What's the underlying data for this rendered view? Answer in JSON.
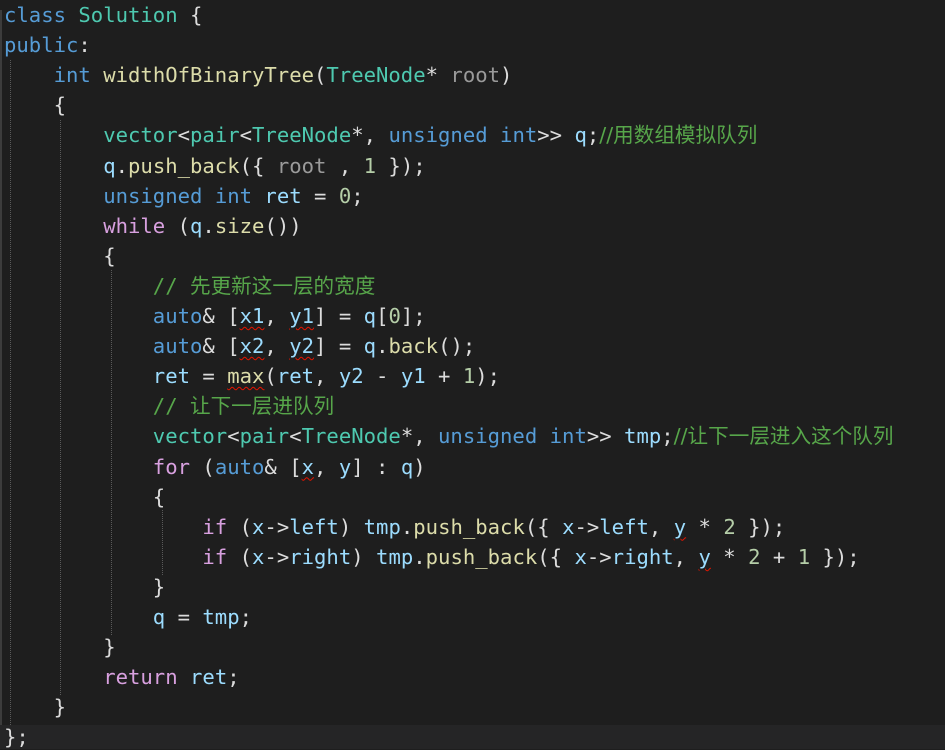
{
  "editor": {
    "lines": [
      [
        [
          "kw",
          "class"
        ],
        [
          "",
          " "
        ],
        [
          "typ",
          "Solution"
        ],
        [
          "",
          " {"
        ]
      ],
      [
        [
          "kw",
          "public"
        ],
        [
          "",
          ":"
        ]
      ],
      [
        [
          "",
          "    "
        ],
        [
          "kw",
          "int"
        ],
        [
          "",
          " "
        ],
        [
          "fn",
          "widthOfBinaryTree"
        ],
        [
          "",
          "("
        ],
        [
          "typ",
          "TreeNode"
        ],
        [
          "",
          "* "
        ],
        [
          "par",
          "root"
        ],
        [
          "",
          ")"
        ]
      ],
      [
        [
          "",
          "    {"
        ]
      ],
      [
        [
          "",
          "        "
        ],
        [
          "typ",
          "vector"
        ],
        [
          "",
          "<"
        ],
        [
          "typ",
          "pair"
        ],
        [
          "",
          "<"
        ],
        [
          "typ",
          "TreeNode"
        ],
        [
          "",
          "*, "
        ],
        [
          "kw",
          "unsigned"
        ],
        [
          "",
          " "
        ],
        [
          "kw",
          "int"
        ],
        [
          "",
          ">> "
        ],
        [
          "var",
          "q"
        ],
        [
          "",
          ";"
        ],
        [
          "com cn",
          "//用数组模拟队列"
        ]
      ],
      [
        [
          "",
          "        "
        ],
        [
          "var",
          "q"
        ],
        [
          "",
          "."
        ],
        [
          "fn",
          "push_back"
        ],
        [
          "",
          "({ "
        ],
        [
          "par",
          "root"
        ],
        [
          "",
          " , "
        ],
        [
          "num",
          "1"
        ],
        [
          "",
          " });"
        ]
      ],
      [
        [
          "",
          "        "
        ],
        [
          "kw",
          "unsigned"
        ],
        [
          "",
          " "
        ],
        [
          "kw",
          "int"
        ],
        [
          "",
          " "
        ],
        [
          "var",
          "ret"
        ],
        [
          "",
          " = "
        ],
        [
          "num",
          "0"
        ],
        [
          "",
          ";"
        ]
      ],
      [
        [
          "",
          "        "
        ],
        [
          "ctl",
          "while"
        ],
        [
          "",
          " ("
        ],
        [
          "var",
          "q"
        ],
        [
          "",
          "."
        ],
        [
          "fn",
          "size"
        ],
        [
          "",
          "())"
        ]
      ],
      [
        [
          "",
          "        {"
        ]
      ],
      [
        [
          "",
          "            "
        ],
        [
          "com",
          "// "
        ],
        [
          "com cn",
          "先更新这一层的宽度"
        ]
      ],
      [
        [
          "",
          "            "
        ],
        [
          "kw",
          "auto"
        ],
        [
          "",
          "& ["
        ],
        [
          "var sq",
          "x1"
        ],
        [
          "",
          ", "
        ],
        [
          "var sq",
          "y1"
        ],
        [
          "",
          "] = "
        ],
        [
          "var",
          "q"
        ],
        [
          "",
          "["
        ],
        [
          "num",
          "0"
        ],
        [
          "",
          "];"
        ]
      ],
      [
        [
          "",
          "            "
        ],
        [
          "kw",
          "auto"
        ],
        [
          "",
          "& ["
        ],
        [
          "var sq",
          "x2"
        ],
        [
          "",
          ", "
        ],
        [
          "var sq",
          "y2"
        ],
        [
          "",
          "] = "
        ],
        [
          "var",
          "q"
        ],
        [
          "",
          "."
        ],
        [
          "fn",
          "back"
        ],
        [
          "",
          "();"
        ]
      ],
      [
        [
          "",
          "            "
        ],
        [
          "var",
          "ret"
        ],
        [
          "",
          " = "
        ],
        [
          "fn sq",
          "max"
        ],
        [
          "",
          "("
        ],
        [
          "var",
          "ret"
        ],
        [
          "",
          ", "
        ],
        [
          "var",
          "y2"
        ],
        [
          "",
          " - "
        ],
        [
          "var",
          "y1"
        ],
        [
          "",
          " + "
        ],
        [
          "num",
          "1"
        ],
        [
          "",
          ");"
        ]
      ],
      [
        [
          "",
          "            "
        ],
        [
          "com",
          "// "
        ],
        [
          "com cn",
          "让下一层进队列"
        ]
      ],
      [
        [
          "",
          "            "
        ],
        [
          "typ",
          "vector"
        ],
        [
          "",
          "<"
        ],
        [
          "typ",
          "pair"
        ],
        [
          "",
          "<"
        ],
        [
          "typ",
          "TreeNode"
        ],
        [
          "",
          "*, "
        ],
        [
          "kw",
          "unsigned"
        ],
        [
          "",
          " "
        ],
        [
          "kw",
          "int"
        ],
        [
          "",
          ">> "
        ],
        [
          "var",
          "tmp"
        ],
        [
          "",
          ";"
        ],
        [
          "com cn",
          "//让下一层进入这个队列"
        ]
      ],
      [
        [
          "",
          "            "
        ],
        [
          "ctl",
          "for"
        ],
        [
          "",
          " ("
        ],
        [
          "kw",
          "auto"
        ],
        [
          "",
          "& ["
        ],
        [
          "var sq",
          "x"
        ],
        [
          "",
          ", "
        ],
        [
          "var",
          "y"
        ],
        [
          "",
          "] : "
        ],
        [
          "var",
          "q"
        ],
        [
          "",
          ")"
        ]
      ],
      [
        [
          "",
          "            {"
        ]
      ],
      [
        [
          "",
          "                "
        ],
        [
          "ctl",
          "if"
        ],
        [
          "",
          " ("
        ],
        [
          "var",
          "x"
        ],
        [
          "",
          "->"
        ],
        [
          "var",
          "left"
        ],
        [
          "",
          ") "
        ],
        [
          "var",
          "tmp"
        ],
        [
          "",
          "."
        ],
        [
          "fn",
          "push_back"
        ],
        [
          "",
          "({ "
        ],
        [
          "var",
          "x"
        ],
        [
          "",
          "->"
        ],
        [
          "var",
          "left"
        ],
        [
          "",
          ", "
        ],
        [
          "var sq",
          "y"
        ],
        [
          "",
          " * "
        ],
        [
          "num",
          "2"
        ],
        [
          "",
          " });"
        ]
      ],
      [
        [
          "",
          "                "
        ],
        [
          "ctl",
          "if"
        ],
        [
          "",
          " ("
        ],
        [
          "var",
          "x"
        ],
        [
          "",
          "->"
        ],
        [
          "var",
          "right"
        ],
        [
          "",
          ") "
        ],
        [
          "var",
          "tmp"
        ],
        [
          "",
          "."
        ],
        [
          "fn",
          "push_back"
        ],
        [
          "",
          "({ "
        ],
        [
          "var",
          "x"
        ],
        [
          "",
          "->"
        ],
        [
          "var",
          "right"
        ],
        [
          "",
          ", "
        ],
        [
          "var sq",
          "y"
        ],
        [
          "",
          " * "
        ],
        [
          "num",
          "2"
        ],
        [
          "",
          " + "
        ],
        [
          "num",
          "1"
        ],
        [
          "",
          " });"
        ]
      ],
      [
        [
          "",
          "            }"
        ]
      ],
      [
        [
          "",
          "            "
        ],
        [
          "var",
          "q"
        ],
        [
          "",
          " = "
        ],
        [
          "var",
          "tmp"
        ],
        [
          "",
          ";"
        ]
      ],
      [
        [
          "",
          "        }"
        ]
      ],
      [
        [
          "",
          "        "
        ],
        [
          "ctl",
          "return"
        ],
        [
          "",
          " "
        ],
        [
          "var",
          "ret"
        ],
        [
          "",
          ";"
        ]
      ],
      [
        [
          "",
          "    }"
        ]
      ],
      [
        [
          "",
          "};"
        ]
      ]
    ]
  }
}
